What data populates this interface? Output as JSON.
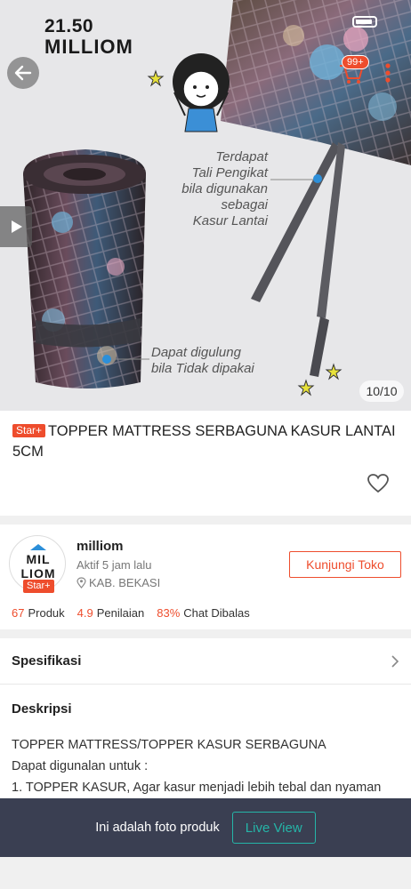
{
  "hero": {
    "brand_price": "21.50",
    "brand_name": "MILLIOM",
    "annotation_1": [
      "Terdapat",
      "Tali Pengikat",
      "bila digunakan",
      "sebagai",
      "Kasur Lantai"
    ],
    "annotation_2": [
      "Dapat digulung",
      "bila Tidak dipakai"
    ],
    "image_counter": "10/10",
    "cart_badge": "99+"
  },
  "product": {
    "badge": "Star+",
    "title": "TOPPER MATTRESS SERBAGUNA KASUR LANTAI 5CM"
  },
  "shop": {
    "avatar_line1": "MIL",
    "avatar_line2": "LIOM",
    "badge": "Star+",
    "name": "milliom",
    "active": "Aktif 5 jam lalu",
    "location": "KAB. BEKASI",
    "visit_label": "Kunjungi Toko",
    "stats": [
      {
        "value": "67",
        "label": "Produk"
      },
      {
        "value": "4.9",
        "label": "Penilaian"
      },
      {
        "value": "83%",
        "label": "Chat Dibalas"
      }
    ]
  },
  "spec": {
    "label": "Spesifikasi"
  },
  "description": {
    "label": "Deskripsi",
    "lines": [
      "TOPPER MATTRESS/TOPPER KASUR SERBAGUNA",
      "Dapat digunalan untuk :",
      "1. TOPPER KASUR, Agar kasur menjadi lebih tebal dan nyaman"
    ]
  },
  "banner": {
    "text": "Ini adalah foto produk",
    "button": "Live View"
  },
  "colors": {
    "accent": "#ee4d2d",
    "live": "#25b5a8",
    "banner_bg": "#3a3f52"
  }
}
